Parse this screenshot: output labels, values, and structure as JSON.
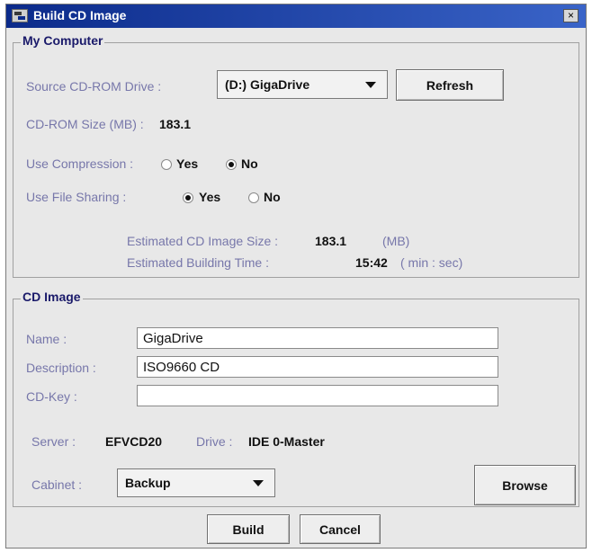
{
  "window": {
    "title": "Build CD Image",
    "close_glyph": "×"
  },
  "my_computer": {
    "group_label": "My Computer",
    "source_label": "Source CD-ROM Drive :",
    "source_value": "(D:) GigaDrive",
    "refresh_label": "Refresh",
    "size_label": "CD-ROM Size (MB) :",
    "size_value": "183.1",
    "compression_label": "Use Compression :",
    "compression_options": [
      "Yes",
      "No"
    ],
    "compression_selected": "No",
    "sharing_label": "Use File Sharing :",
    "sharing_options": [
      "Yes",
      "No"
    ],
    "sharing_selected": "Yes",
    "est_size_label": "Estimated CD Image Size :",
    "est_size_value": "183.1",
    "est_size_unit": "(MB)",
    "est_time_label": "Estimated Building Time :",
    "est_time_value": "15:42",
    "est_time_unit": "( min : sec)"
  },
  "cd_image": {
    "group_label": "CD Image",
    "name_label": "Name :",
    "name_value": "GigaDrive",
    "description_label": "Description :",
    "description_value": "ISO9660 CD",
    "cdkey_label": "CD-Key :",
    "cdkey_value": "",
    "server_label": "Server :",
    "server_value": "EFVCD20",
    "drive_label": "Drive :",
    "drive_value": "IDE 0-Master",
    "cabinet_label": "Cabinet :",
    "cabinet_value": "Backup",
    "browse_label": "Browse"
  },
  "footer": {
    "build_label": "Build",
    "cancel_label": "Cancel"
  }
}
